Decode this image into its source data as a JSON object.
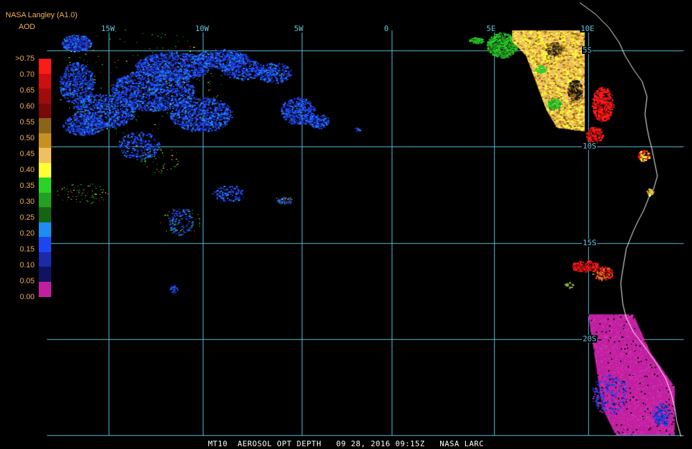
{
  "header": {
    "source": "NASA Langley (A1.0)",
    "product": "AOD"
  },
  "legend": {
    "items": [
      {
        "label": ">0.75",
        "color": "#ff1a1a"
      },
      {
        "label": "0.70",
        "color": "#cc1010"
      },
      {
        "label": "0.65",
        "color": "#a00c0c"
      },
      {
        "label": "0.60",
        "color": "#7a0a0a"
      },
      {
        "label": "0.55",
        "color": "#8c6418"
      },
      {
        "label": "0.50",
        "color": "#c8901e"
      },
      {
        "label": "0.45",
        "color": "#f0c060"
      },
      {
        "label": "0.40",
        "color": "#ffff32"
      },
      {
        "label": "0.35",
        "color": "#2ad22a"
      },
      {
        "label": "0.30",
        "color": "#22a022"
      },
      {
        "label": "0.25",
        "color": "#146414"
      },
      {
        "label": "0.20",
        "color": "#1e8cf0"
      },
      {
        "label": "0.15",
        "color": "#1e46f0"
      },
      {
        "label": "0.10",
        "color": "#1a2aa8"
      },
      {
        "label": "0.05",
        "color": "#101460"
      },
      {
        "label": "0.00",
        "color": "#c020a0"
      }
    ]
  },
  "grid": {
    "color": "#50c8dc",
    "longitudes": [
      "15W",
      "10W",
      "5W",
      "0",
      "5E",
      "10E"
    ],
    "latitudes": [
      "5S",
      "10S",
      "15S",
      "20S"
    ]
  },
  "colors": {
    "coastline": "#ffffff",
    "background": "#000000"
  },
  "caption": "MT10  AEROSOL OPT DEPTH   09 28, 2016 09:15Z   NASA LARC"
}
